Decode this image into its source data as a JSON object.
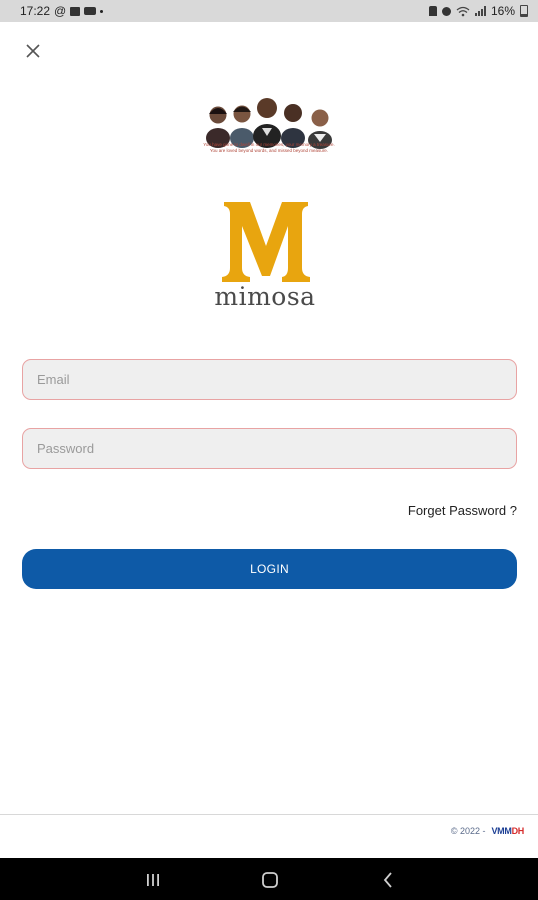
{
  "status_bar": {
    "time": "17:22",
    "at_symbol": "@",
    "battery": "16%"
  },
  "banner": {
    "caption_line1": "You have gone to dwell in our memories, your memory a treasure.",
    "caption_line2": "You are loved beyond words, and missed beyond measure."
  },
  "logo": {
    "letter": "M",
    "wordmark": "mimosa",
    "color": "#e8a50f"
  },
  "form": {
    "email_placeholder": "Email",
    "password_placeholder": "Password",
    "forget_password": "Forget Password ?",
    "login_label": "LOGIN",
    "button_color": "#0e5aa7"
  },
  "footer": {
    "copyright": "© 2022 -",
    "brand_part1": "VMM",
    "brand_part2": "DH"
  },
  "nav": {
    "recent": "recent-apps-icon",
    "home": "home-icon",
    "back": "back-icon"
  }
}
